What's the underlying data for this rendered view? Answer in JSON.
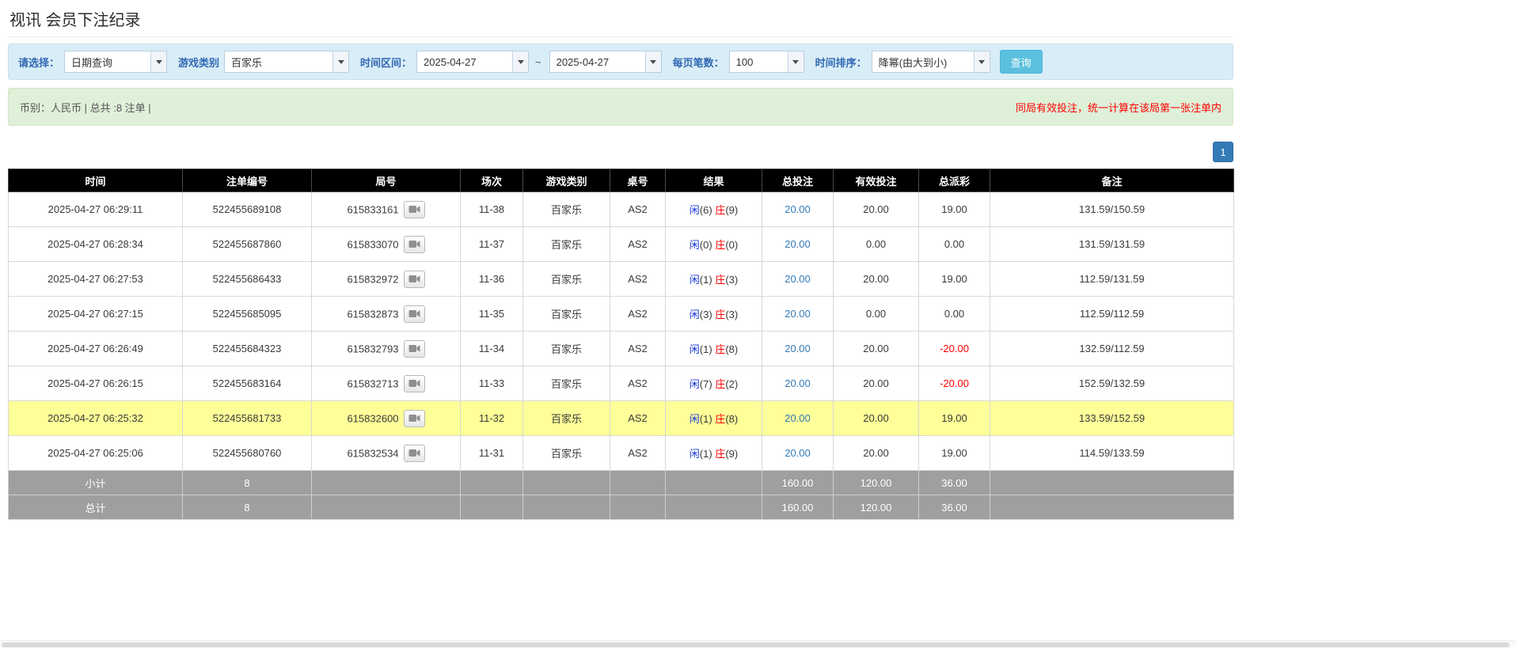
{
  "page": {
    "title": "视讯 会员下注纪录"
  },
  "filters": {
    "select_label": "请选择：",
    "select_value": "日期查询",
    "game_type_label": "游戏类别",
    "game_type_value": "百家乐",
    "date_range_label": "时间区间：",
    "date_from": "2025-04-27",
    "range_separator": "~",
    "date_to": "2025-04-27",
    "page_size_label": "每页笔数：",
    "page_size_value": "100",
    "sort_label": "时间排序：",
    "sort_value": "降幂(由大到小)",
    "search_button": "查询"
  },
  "summary": {
    "info": "币别：人民币 | 总共 :8 注单 |",
    "notice": "同局有效投注，统一计算在该局第一张注单内"
  },
  "pagination": {
    "page": "1"
  },
  "icons": {
    "dropdown_arrow": "▼",
    "video_camera": "video-camera-shape"
  },
  "colors": {
    "filter_bar_bg": "#d9edf7",
    "summary_bar_bg": "#dff0d8",
    "label_blue": "#3169b3",
    "search_button_bg": "#5bc0de",
    "pagination_bg": "#337ab7",
    "table_header_bg": "#000000",
    "highlight_row_bg": "#ffff99",
    "footer_row_bg": "#9f9f9f",
    "link_blue": "#337ab7",
    "player_blue": "#1633d8",
    "banker_red": "#ff0000",
    "negative_red": "#ff0000",
    "notice_red": "#ff0000"
  },
  "table": {
    "headers": [
      "时间",
      "注单编号",
      "局号",
      "场次",
      "游戏类别",
      "桌号",
      "结果",
      "总投注",
      "有效投注",
      "总派彩",
      "备注"
    ],
    "rows": [
      {
        "time": "2025-04-27 06:29:11",
        "bet_id": "522455689108",
        "round_id": "615833161",
        "session": "11-38",
        "game": "百家乐",
        "table_no": "AS2",
        "result": {
          "player": "闲",
          "player_score": "(6)",
          "banker": "庄",
          "banker_score": "(9)"
        },
        "total_bet": "20.00",
        "valid_bet": "20.00",
        "payout": "19.00",
        "remark": "131.59/150.59",
        "highlight": false
      },
      {
        "time": "2025-04-27 06:28:34",
        "bet_id": "522455687860",
        "round_id": "615833070",
        "session": "11-37",
        "game": "百家乐",
        "table_no": "AS2",
        "result": {
          "player": "闲",
          "player_score": "(0)",
          "banker": "庄",
          "banker_score": "(0)"
        },
        "total_bet": "20.00",
        "valid_bet": "0.00",
        "payout": "0.00",
        "remark": "131.59/131.59",
        "highlight": false
      },
      {
        "time": "2025-04-27 06:27:53",
        "bet_id": "522455686433",
        "round_id": "615832972",
        "session": "11-36",
        "game": "百家乐",
        "table_no": "AS2",
        "result": {
          "player": "闲",
          "player_score": "(1)",
          "banker": "庄",
          "banker_score": "(3)"
        },
        "total_bet": "20.00",
        "valid_bet": "20.00",
        "payout": "19.00",
        "remark": "112.59/131.59",
        "highlight": false
      },
      {
        "time": "2025-04-27 06:27:15",
        "bet_id": "522455685095",
        "round_id": "615832873",
        "session": "11-35",
        "game": "百家乐",
        "table_no": "AS2",
        "result": {
          "player": "闲",
          "player_score": "(3)",
          "banker": "庄",
          "banker_score": "(3)"
        },
        "total_bet": "20.00",
        "valid_bet": "0.00",
        "payout": "0.00",
        "remark": "112.59/112.59",
        "highlight": false
      },
      {
        "time": "2025-04-27 06:26:49",
        "bet_id": "522455684323",
        "round_id": "615832793",
        "session": "11-34",
        "game": "百家乐",
        "table_no": "AS2",
        "result": {
          "player": "闲",
          "player_score": "(1)",
          "banker": "庄",
          "banker_score": "(8)"
        },
        "total_bet": "20.00",
        "valid_bet": "20.00",
        "payout": "-20.00",
        "remark": "132.59/112.59",
        "highlight": false
      },
      {
        "time": "2025-04-27 06:26:15",
        "bet_id": "522455683164",
        "round_id": "615832713",
        "session": "11-33",
        "game": "百家乐",
        "table_no": "AS2",
        "result": {
          "player": "闲",
          "player_score": "(7)",
          "banker": "庄",
          "banker_score": "(2)"
        },
        "total_bet": "20.00",
        "valid_bet": "20.00",
        "payout": "-20.00",
        "remark": "152.59/132.59",
        "highlight": false
      },
      {
        "time": "2025-04-27 06:25:32",
        "bet_id": "522455681733",
        "round_id": "615832600",
        "session": "11-32",
        "game": "百家乐",
        "table_no": "AS2",
        "result": {
          "player": "闲",
          "player_score": "(1)",
          "banker": "庄",
          "banker_score": "(8)"
        },
        "total_bet": "20.00",
        "valid_bet": "20.00",
        "payout": "19.00",
        "remark": "133.59/152.59",
        "highlight": true
      },
      {
        "time": "2025-04-27 06:25:06",
        "bet_id": "522455680760",
        "round_id": "615832534",
        "session": "11-31",
        "game": "百家乐",
        "table_no": "AS2",
        "result": {
          "player": "闲",
          "player_score": "(1)",
          "banker": "庄",
          "banker_score": "(9)"
        },
        "total_bet": "20.00",
        "valid_bet": "20.00",
        "payout": "19.00",
        "remark": "114.59/133.59",
        "highlight": false
      }
    ],
    "footer": [
      {
        "label": "小计",
        "count": "8",
        "total_bet": "160.00",
        "valid_bet": "120.00",
        "payout": "36.00"
      },
      {
        "label": "总计",
        "count": "8",
        "total_bet": "160.00",
        "valid_bet": "120.00",
        "payout": "36.00"
      }
    ]
  }
}
